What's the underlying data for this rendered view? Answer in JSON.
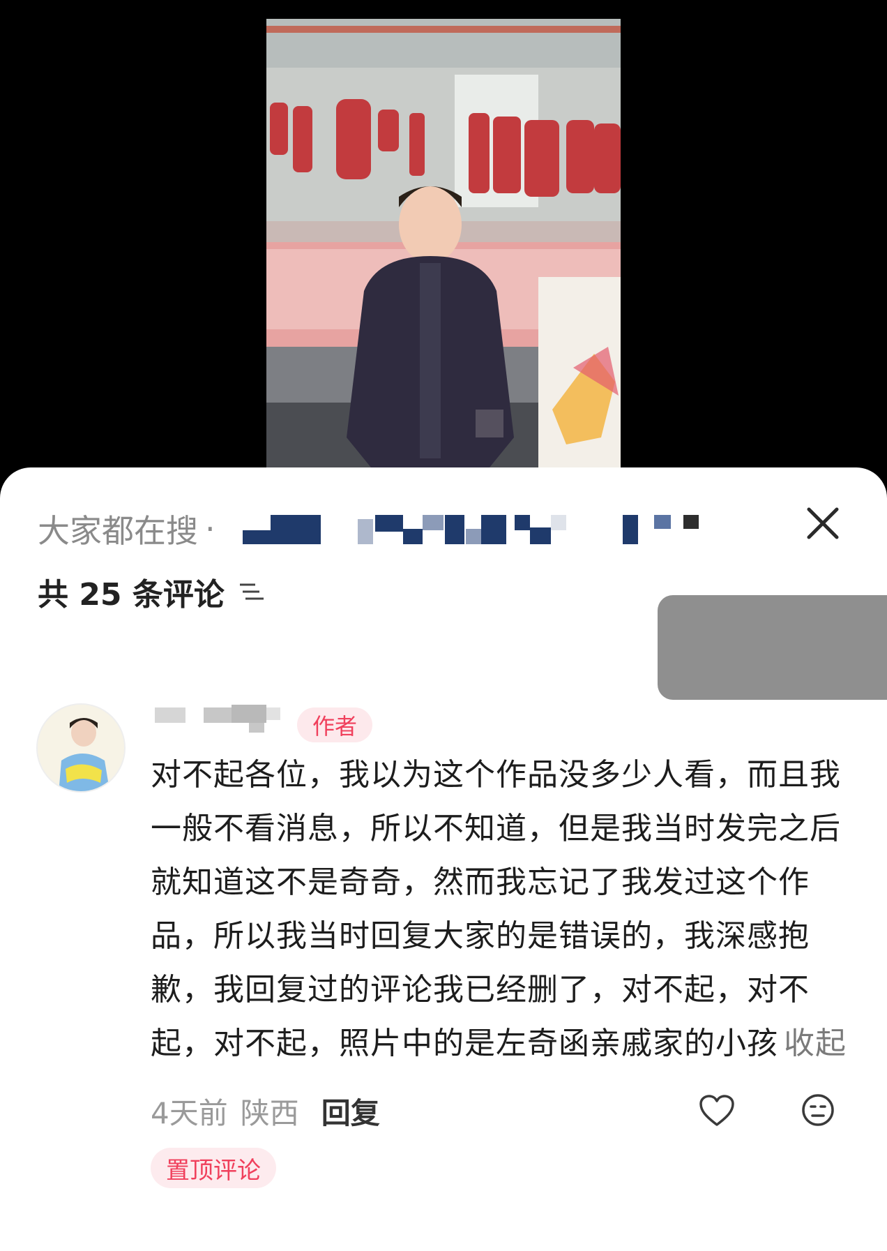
{
  "panel": {
    "search_prefix": "大家都在搜",
    "search_dot": "·",
    "comment_count_label": "共 25 条评论"
  },
  "comment": {
    "author_badge": "作者",
    "text": "对不起各位，我以为这个作品没多少人看，而且我一般不看消息，所以不知道，但是我当时发完之后就知道这不是奇奇，然而我忘记了我发过这个作品，所以我当时回复大家的是错误的，我深感抱歉，我回复过的评论我已经删了，对不起，对不起，对不起，照片中的是左奇函亲戚家的小孩",
    "collapse_label": "收起",
    "time": "4天前",
    "location": "陕西",
    "reply_label": "回复",
    "pinned_label": "置顶评论"
  },
  "icons": {
    "close": "close-icon",
    "sort": "sort-icon",
    "like": "heart-icon",
    "emoji": "emoji-icon"
  },
  "colors": {
    "badge_text": "#f0405c",
    "badge_bg": "#fde9ec",
    "muted": "#9a9a9a",
    "blur_blue": "#1f3a6b"
  }
}
